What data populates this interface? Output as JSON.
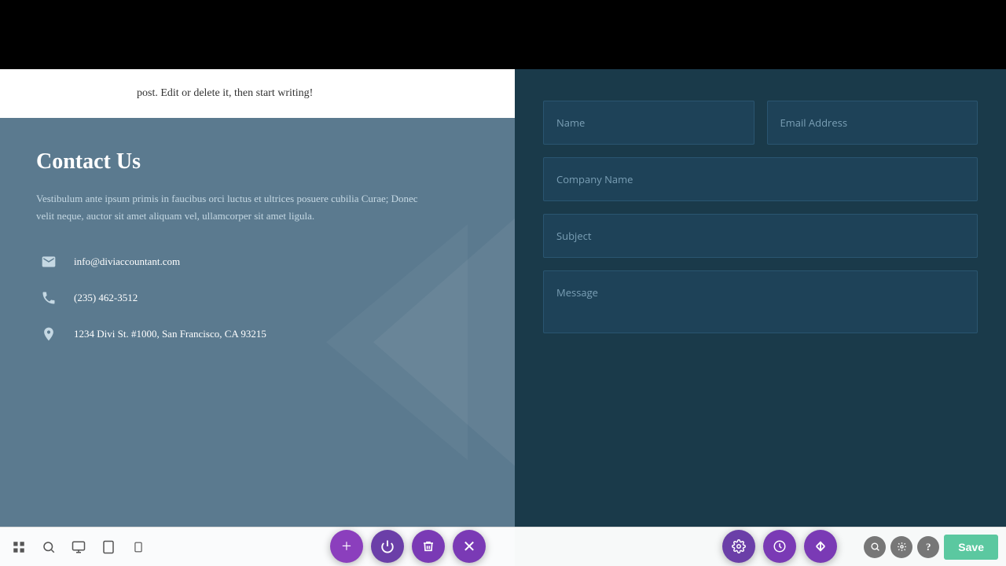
{
  "top_bar": {
    "bg": "#000000"
  },
  "blog_section": {
    "text": "post. Edit or delete it, then start writing!"
  },
  "contact": {
    "title": "Contact Us",
    "description": "Vestibulum ante ipsum primis in faucibus orci luctus et ultrices posuere cubilia Curae; Donec velit neque, auctor sit amet aliquam vel, ullamcorper sit amet ligula.",
    "email": "info@diviaccountant.com",
    "phone": "(235) 462-3512",
    "address": "1234 Divi St. #1000, San Francisco, CA 93215"
  },
  "form": {
    "name_placeholder": "Name",
    "email_placeholder": "Email Address",
    "company_placeholder": "Company Name",
    "subject_placeholder": "Subject",
    "message_placeholder": "Message"
  },
  "toolbar": {
    "save_label": "Save",
    "fab_add": "+",
    "fab_power": "⏻",
    "fab_trash": "🗑",
    "fab_close": "✕"
  }
}
